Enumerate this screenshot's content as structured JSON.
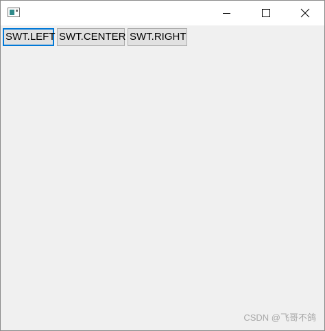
{
  "window": {
    "title": "",
    "app_icon": "window-app-icon",
    "controls": {
      "minimize_icon": "minimize-icon",
      "maximize_icon": "maximize-icon",
      "close_icon": "close-icon"
    }
  },
  "buttons": {
    "left_label": "SWT.LEFT",
    "center_label": "SWT.CENTER",
    "right_label": "SWT.RIGHT",
    "focused": "SWT.LEFT"
  },
  "colors": {
    "client_background": "#f0f0f0",
    "focus_border": "#0078d7",
    "button_face": "#e1e1e1"
  },
  "watermark": {
    "text": "CSDN @飞哥不鸽"
  }
}
